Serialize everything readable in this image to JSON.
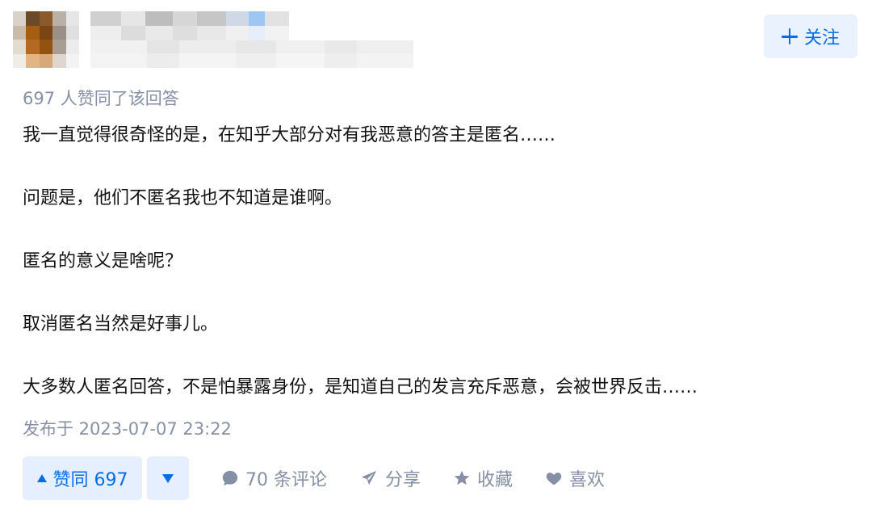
{
  "header": {
    "avatar_alt": "",
    "follow_label": "关注"
  },
  "answer": {
    "vote_summary": "697 人赞同了该回答",
    "paragraphs": [
      "我一直觉得很奇怪的是，在知乎大部分对有我恶意的答主是匿名……",
      "问题是，他们不匿名我也不知道是谁啊。",
      "匿名的意义是啥呢？",
      "取消匿名当然是好事儿。",
      "大多数人匿名回答，不是怕暴露身份，是知道自己的发言充斥恶意，会被世界反击……"
    ],
    "publish_time": "发布于 2023-07-07 23:22"
  },
  "actions": {
    "upvote_label": "赞同 697",
    "comments_label": "70 条评论",
    "share_label": "分享",
    "collect_label": "收藏",
    "like_label": "喜欢"
  },
  "colors": {
    "accent": "#056de8",
    "accent_bg": "#e5efff",
    "meta_text": "#8590a6",
    "body_text": "#121212"
  },
  "icons": {
    "follow": "plus-icon",
    "upvote": "triangle-up-icon",
    "downvote": "triangle-down-icon",
    "comment": "comment-bubble-icon",
    "share": "paper-plane-icon",
    "collect": "star-icon",
    "like": "heart-icon"
  }
}
